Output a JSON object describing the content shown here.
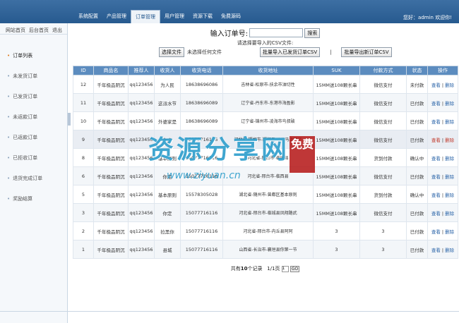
{
  "topnav": {
    "tabs": [
      "系统配置",
      "产品管理",
      "订单管理",
      "用户管理",
      "资源下载",
      "免费源码"
    ],
    "active": "订单管理",
    "welcome": "您好：admin  欢迎你!"
  },
  "sidebar": {
    "links": [
      "网站首页",
      "后台首页",
      "退出"
    ],
    "items": [
      "订单列表",
      "未发货订单",
      "已发货订单",
      "未返款订单",
      "已返款订单",
      "已拒收订单",
      "退货完成订单",
      "奖励结算"
    ]
  },
  "search": {
    "label": "输入订单号:",
    "input_value": "",
    "button": "搜索"
  },
  "csv": {
    "label": "请选择要导入的CSV文件:",
    "choose_button": "选择文件",
    "no_file": "未选择任何文件",
    "import_button": "批量导入已发货订单CSV",
    "export_button": "批量导出新订单CSV"
  },
  "table": {
    "headers": [
      "ID",
      "商品名",
      "推荐人",
      "收货人",
      "收货电话",
      "收货地址",
      "SUK",
      "付款方式",
      "状态",
      "操作"
    ],
    "rows": [
      {
        "id": "12",
        "product": "千年极品阴沉",
        "referrer": "qq123456",
        "name": "为人民",
        "phone": "18638696086",
        "address": "吉林省-松原市-扶余市油切性",
        "suk": "15MM送108颗长串",
        "payment": "微信支付",
        "status": "未付款",
        "op_view": "查看",
        "op_del": "删除"
      },
      {
        "id": "11",
        "product": "千年极品阴沉",
        "referrer": "qq123456",
        "name": "这派水节",
        "phone": "18638696089",
        "address": "辽宁省-丹东市-东港市海盈影",
        "suk": "15MM送108颗长串",
        "payment": "微信支付",
        "status": "已付款",
        "op_view": "查看",
        "op_del": "删除"
      },
      {
        "id": "10",
        "product": "千年极品阴沉",
        "referrer": "qq123456",
        "name": "外婆家是",
        "phone": "18638696089",
        "address": "辽宁省-锦州市-凌海市鸟叔破",
        "suk": "15MM送108颗长串",
        "payment": "微信支付",
        "status": "已付款",
        "op_view": "查看",
        "op_del": "删除"
      },
      {
        "id": "9",
        "product": "千年极品阴沉",
        "referrer": "qq123456",
        "name": "你定",
        "phone": "15077716116",
        "address": "河北省-邯郸市-邯郸县XP二马上睡了",
        "suk": "15MM送108颗长串",
        "payment": "微信支付",
        "status": "已付款",
        "op_view": "查看",
        "op_del": "删除"
      },
      {
        "id": "8",
        "product": "千年极品阴沉",
        "referrer": "qq123456",
        "name": "基本原则",
        "phone": "15077716116",
        "address": "河北省-邢台市-临城县",
        "suk": "15MM送108颗长串",
        "payment": "货到付款",
        "status": "确认中",
        "op_view": "查看",
        "op_del": "删除"
      },
      {
        "id": "6",
        "product": "千年极品阴沉",
        "referrer": "qq123456",
        "name": "你定",
        "phone": "15077716116",
        "address": "河北省-邢台市-临西县",
        "suk": "15MM送108颗长串",
        "payment": "微信支付",
        "status": "已付款",
        "op_view": "查看",
        "op_del": "删除"
      },
      {
        "id": "5",
        "product": "千年极品阴沉",
        "referrer": "qq123456",
        "name": "基本原则",
        "phone": "15578305028",
        "address": "湖北省-随州市-曾都区基本原则",
        "suk": "15MM送108颗长串",
        "payment": "货到付款",
        "status": "确认中",
        "op_view": "查看",
        "op_del": "删除"
      },
      {
        "id": "3",
        "product": "千年极品阴沉",
        "referrer": "qq123456",
        "name": "你定",
        "phone": "15077716116",
        "address": "河北省-邢台市-临城县凤翔路武",
        "suk": "15MM送108颗长串",
        "payment": "微信支付",
        "status": "已付款",
        "op_view": "查看",
        "op_del": "删除"
      },
      {
        "id": "2",
        "product": "千年极品阴沉",
        "referrer": "qq123456",
        "name": "拉黑你",
        "phone": "15077716116",
        "address": "河北省-邢台市-内丘县阿阿",
        "suk": "3",
        "payment": "3",
        "status": "已付款",
        "op_view": "查看",
        "op_del": "删除"
      },
      {
        "id": "1",
        "product": "千年极品阴沉",
        "referrer": "qq123456",
        "name": "县城",
        "phone": "15077716116",
        "address": "山西省-长治市-襄垣县你第一节",
        "suk": "3",
        "payment": "3",
        "status": "已付款",
        "op_view": "查看",
        "op_del": "删除"
      }
    ]
  },
  "pager": {
    "total_prefix": "共有",
    "total": "10",
    "total_suffix": "个记录",
    "page": "1/1页",
    "page_input": "1",
    "go": "GO"
  },
  "watermark": {
    "text": "资源分享网",
    "url": "www.ziyuan.cn",
    "seal": "免费"
  }
}
